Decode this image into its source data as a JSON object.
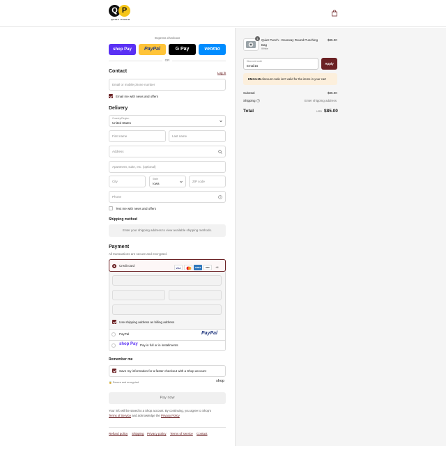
{
  "brand": {
    "logo_letters": [
      "Q",
      "P"
    ],
    "logo_text": "QUIET PUNCH"
  },
  "express": {
    "title": "Express checkout",
    "buttons": [
      {
        "label": "shop Pay",
        "bg": "#5a31f4",
        "fg": "#ffffff"
      },
      {
        "label": "PayPal",
        "bg": "#ffc439",
        "fg": "#253b80"
      },
      {
        "label": "G Pay",
        "bg": "#000000",
        "fg": "#ffffff"
      },
      {
        "label": "venmo",
        "bg": "#008cff",
        "fg": "#ffffff"
      }
    ],
    "or": "OR"
  },
  "contact": {
    "title": "Contact",
    "login": "Log in",
    "email_placeholder": "Email or mobile phone number",
    "news_label": "Email me with news and offers"
  },
  "delivery": {
    "title": "Delivery",
    "country_label": "Country/Region",
    "country_value": "United States",
    "first_name": "First name",
    "last_name": "Last name",
    "address": "Address",
    "apartment": "Apartment, suite, etc. (optional)",
    "city": "City",
    "state_label": "State",
    "state_value": "Iowa",
    "zip": "ZIP code",
    "phone": "Phone",
    "text_label": "Text me with news and offers"
  },
  "shipping_method": {
    "title": "Shipping method",
    "note": "Enter your shipping address to view available shipping methods."
  },
  "payment": {
    "title": "Payment",
    "subtitle": "All transactions are secure and encrypted.",
    "credit_card": "Credit card",
    "cards": [
      "VISA",
      "MC",
      "AMEX",
      "DISC"
    ],
    "more_cards": "+4",
    "billing_label": "Use shipping address as billing address",
    "paypal_label": "PayPal",
    "paypal_logo": "PayPal",
    "shoppay_logo": "shop Pay",
    "shoppay_label": "Pay in full or in installments"
  },
  "remember": {
    "title": "Remember me",
    "save_label": "Save my information for a faster checkout with a Shop account",
    "secure": "Secure and encrypted",
    "shop_logo": "shop"
  },
  "pay_now": "Pay now",
  "disclaimer": {
    "line1": "Your info will be saved to a Shop account. By continuing, you agree to Shop's",
    "tos": "Terms of Service",
    "mid": "and acknowledge the",
    "privacy": "Privacy Policy"
  },
  "footer_links": [
    "Refund policy",
    "Shipping",
    "Privacy policy",
    "Terms of service",
    "Contact"
  ],
  "summary": {
    "item_qty": "1",
    "item_name": "Quiet Punch - Doorway Round Punching Bag",
    "item_variant": "White",
    "item_price": "$85.00",
    "discount_label": "Discount code",
    "discount_value": "Email15",
    "apply": "Apply",
    "error_code": "EMAIL15",
    "error_text": "discount code isn't valid for the items in your cart",
    "subtotal_label": "Subtotal",
    "subtotal_value": "$85.00",
    "shipping_label": "Shipping",
    "shipping_value": "Enter shipping address",
    "total_label": "Total",
    "currency": "USD",
    "total_value": "$85.00"
  },
  "colors": {
    "accent": "#6b2124",
    "error_bg": "#fcefdc"
  }
}
